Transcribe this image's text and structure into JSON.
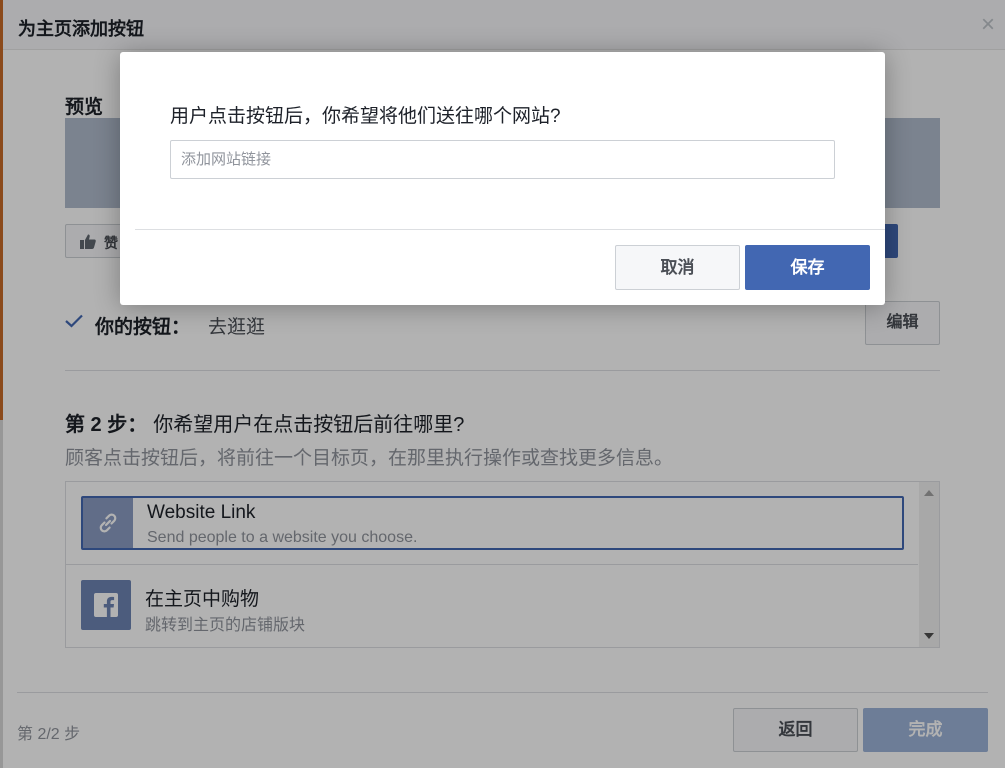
{
  "dialog": {
    "title": "为主页添加按钮",
    "close_glyph": "×",
    "preview": {
      "label": "预览",
      "like_label": "赞"
    },
    "your_button": {
      "label": "你的按钮：",
      "value": "去逛逛",
      "edit_label": "编辑"
    },
    "step": {
      "number": "第 2 步：",
      "question": "你希望用户在点击按钮后前往哪里?",
      "description": "顾客点击按钮后，将前往一个目标页，在那里执行操作或查找更多信息。"
    },
    "options": [
      {
        "title": "Website Link",
        "subtitle": "Send people to a website you choose.",
        "icon": "link-icon",
        "selected": true
      },
      {
        "title": "在主页中购物",
        "subtitle": "跳转到主页的店铺版块",
        "icon": "facebook-icon",
        "selected": false
      }
    ],
    "footer": {
      "step_counter": "第 2/2 步",
      "back_label": "返回",
      "finish_label": "完成"
    }
  },
  "modal": {
    "question": "用户点击按钮后，你希望将他们送往哪个网站?",
    "input": {
      "value": "",
      "placeholder": "添加网站链接"
    },
    "cancel_label": "取消",
    "save_label": "保存"
  },
  "colors": {
    "primary": "#4267b2",
    "primary_disabled": "#9cb4d8",
    "icon_bg": "#8b9dc3",
    "text_dark": "#1d2129",
    "text_muted": "#90949c",
    "border": "#ccd0d5"
  }
}
